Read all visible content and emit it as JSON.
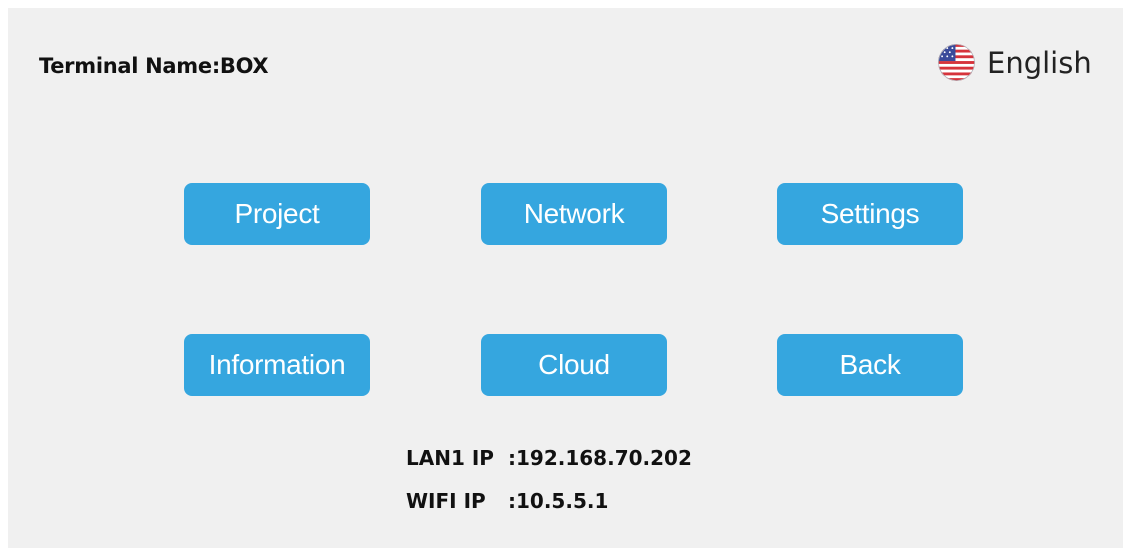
{
  "header": {
    "terminal_name": "Terminal Name:BOX",
    "language": {
      "label": "English",
      "icon": "us-flag-icon"
    }
  },
  "menu": {
    "buttons": [
      {
        "label": "Project"
      },
      {
        "label": "Network"
      },
      {
        "label": "Settings"
      },
      {
        "label": "Information"
      },
      {
        "label": "Cloud"
      },
      {
        "label": "Back"
      }
    ]
  },
  "ips": {
    "lan1": {
      "label": "LAN1 IP",
      "value": ":192.168.70.202"
    },
    "wifi": {
      "label": "WIFI IP",
      "value": ":10.5.5.1"
    }
  },
  "colors": {
    "button": "#35a6df",
    "button_text": "#ffffff",
    "background": "#f0f0f0"
  }
}
